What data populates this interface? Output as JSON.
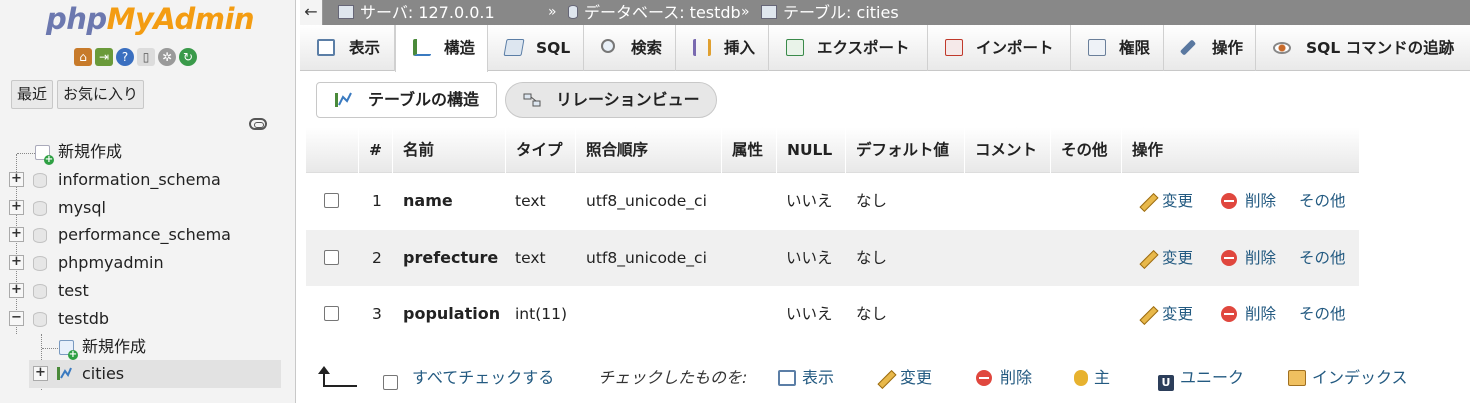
{
  "nav": {
    "logo_a": "php",
    "logo_b": "MyAdmin",
    "icons": [
      "home-icon",
      "exit-icon",
      "help-icon",
      "docs-icon",
      "settings-icon",
      "reload-icon"
    ],
    "tabs": [
      "最近",
      "お気に入り"
    ],
    "tree": {
      "new_top": "新規作成",
      "databases": [
        "information_schema",
        "mysql",
        "performance_schema",
        "phpmyadmin",
        "test",
        "testdb"
      ],
      "testdb_children": {
        "new": "新規作成",
        "table": "cities"
      }
    }
  },
  "breadcrumb": {
    "back": "←",
    "server": "サーバ: 127.0.0.1",
    "sep": "»",
    "database": "データベース: testdb",
    "table": "テーブル: cities"
  },
  "menu": {
    "tabs": [
      {
        "label": "表示",
        "color": "#5b7ea6"
      },
      {
        "label": "構造",
        "color": "#4a8a3a"
      },
      {
        "label": "SQL",
        "color": "#5b7ea6"
      },
      {
        "label": "検索",
        "color": "#8a8a8a"
      },
      {
        "label": "挿入",
        "color": "#7a6ab0"
      },
      {
        "label": "エクスポート",
        "color": "#3a8a4a"
      },
      {
        "label": "インポート",
        "color": "#c0392b"
      },
      {
        "label": "権限",
        "color": "#6a7f9a"
      },
      {
        "label": "操作",
        "color": "#5a78a0"
      },
      {
        "label": "SQL コマンドの追跡",
        "color": "#8a8a8a"
      }
    ]
  },
  "subtabs": {
    "structure": "テーブルの構造",
    "relation": "リレーションビュー"
  },
  "table": {
    "headers": [
      "#",
      "名前",
      "タイプ",
      "照合順序",
      "属性",
      "NULL",
      "デフォルト値",
      "コメント",
      "その他",
      "操作"
    ],
    "rows": [
      {
        "num": "1",
        "name": "name",
        "type": "text",
        "collation": "utf8_unicode_ci",
        "attr": "",
        "null": "いいえ",
        "default": "なし",
        "comment": "",
        "extra": ""
      },
      {
        "num": "2",
        "name": "prefecture",
        "type": "text",
        "collation": "utf8_unicode_ci",
        "attr": "",
        "null": "いいえ",
        "default": "なし",
        "comment": "",
        "extra": ""
      },
      {
        "num": "3",
        "name": "population",
        "type": "int(11)",
        "collation": "",
        "attr": "",
        "null": "いいえ",
        "default": "なし",
        "comment": "",
        "extra": ""
      }
    ],
    "actions": {
      "change": "変更",
      "drop": "削除",
      "more": "その他"
    }
  },
  "bottom": {
    "check_all": "すべてチェックする",
    "with_selected": "チェックしたものを:",
    "browse": "表示",
    "change": "変更",
    "drop": "削除",
    "primary": "主",
    "unique": "ユニーク",
    "index": "インデックス"
  },
  "colors": {
    "link": "#235a81",
    "breadcrumb_bg": "#888888"
  }
}
